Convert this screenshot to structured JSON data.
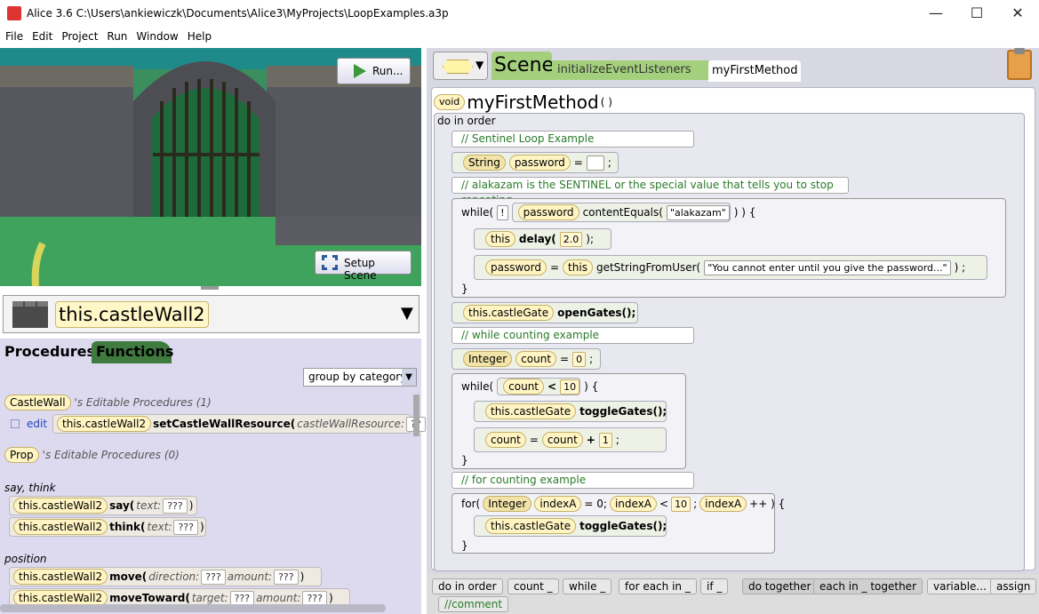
{
  "window": {
    "title": "Alice 3.6 C:\\Users\\ankiewiczk\\Documents\\Alice3\\MyProjects\\LoopExamples.a3p",
    "minimize": "—",
    "maximize": "☐",
    "close": "✕"
  },
  "menu": [
    "File",
    "Edit",
    "Project",
    "Run",
    "Window",
    "Help"
  ],
  "scene_view": {
    "run_label": "Run...",
    "setup_label": "Setup Scene"
  },
  "object_selector": {
    "name": "this.castleWall2",
    "arrow": "▼"
  },
  "panel_tabs": {
    "procedures": "Procedures",
    "functions": "Functions"
  },
  "group_by": {
    "value": "group by category",
    "arrow": "▼"
  },
  "procedures": {
    "castlewall_type": "CastleWall",
    "castlewall_header": "'s Editable Procedures (1)",
    "edit_label": "edit",
    "setres_target": "this.castleWall2",
    "setres_method": "setCastleWallResource(",
    "setres_param": "castleWallResource:",
    "setres_val": "??",
    "prop_type": "Prop",
    "prop_header": "'s Editable Procedures (0)",
    "cat_saythink": "say, think",
    "say_target": "this.castleWall2",
    "say_method": "say(",
    "say_param": "text:",
    "say_val": "???",
    "say_close": ")",
    "think_target": "this.castleWall2",
    "think_method": "think(",
    "think_param": "text:",
    "think_val": "???",
    "think_close": ")",
    "cat_position": "position",
    "move_target": "this.castleWall2",
    "move_method": "move(",
    "move_p1": "direction:",
    "move_v1": "???",
    "move_p2": "amount:",
    "move_v2": "???",
    "move_close": ")",
    "movetoward_target": "this.castleWall2",
    "movetoward_method": "moveToward(",
    "movetoward_p1": "target:",
    "movetoward_v1": "???",
    "movetoward_p2": "amount:",
    "movetoward_v2": "???",
    "movetoward_close": ")"
  },
  "editor_tabs": {
    "scene": "Scene",
    "init": "initializeEventListeners",
    "method": "myFirstMethod"
  },
  "method_header": {
    "void": "void",
    "name": "myFirstMethod",
    "parens": "( )"
  },
  "code": {
    "do_in_order": "do in order",
    "c1": "// Sentinel Loop Example",
    "s1_type": "String",
    "s1_var": "password",
    "s1_eq": "=",
    "s1_end": ";",
    "c2": "// alakazam is the SENTINEL or the special value that tells you to stop repeating",
    "w1_kw": "while(",
    "w1_not": "!",
    "w1_var": "password",
    "w1_fn": "contentEquals(",
    "w1_str": "\"alakazam\"",
    "w1_close": ") ) {",
    "d1_this": "this",
    "d1_fn": "delay(",
    "d1_val": "2.0",
    "d1_end": ");",
    "a1_var": "password",
    "a1_eq": "=",
    "a1_this": "this",
    "a1_fn": "getStringFromUser(",
    "a1_str": "\"You cannot enter until you give the password...\"",
    "a1_end": ") ;",
    "w1_end": "}",
    "og_target": "this.castleGate",
    "og_fn": "openGates();",
    "c3": "// while counting example",
    "i1_type": "Integer",
    "i1_var": "count",
    "i1_eq": "=",
    "i1_val": "0",
    "i1_end": ";",
    "w2_kw": "while(",
    "w2_var": "count",
    "w2_op": "<",
    "w2_val": "10",
    "w2_close": ") {",
    "tg1_target": "this.castleGate",
    "tg1_fn": "toggleGates();",
    "inc_var": "count",
    "inc_eq": "=",
    "inc_var2": "count",
    "inc_op": "+",
    "inc_val": "1",
    "inc_end": ";",
    "w2_end": "}",
    "c4": "// for counting example",
    "f_kw": "for(",
    "f_type": "Integer",
    "f_var": "indexA",
    "f_init": "= 0;",
    "f_var2": "indexA",
    "f_op": "<",
    "f_val": "10",
    "f_semi": ";",
    "f_var3": "indexA",
    "f_inc": "++ ) {",
    "tg2_target": "this.castleGate",
    "tg2_fn": "toggleGates();",
    "f_end": "}"
  },
  "controls": [
    "do in order",
    "count _",
    "while _",
    "for each in _",
    "if _",
    "do together",
    "each in _ together",
    "variable...",
    "assign",
    "//comment"
  ],
  "colors": {
    "panel_lavender": "#dddaf0",
    "tile_yellow": "#fff4c2",
    "comment_green": "#2a7a2a",
    "tab_green": "#3f7a3f"
  }
}
